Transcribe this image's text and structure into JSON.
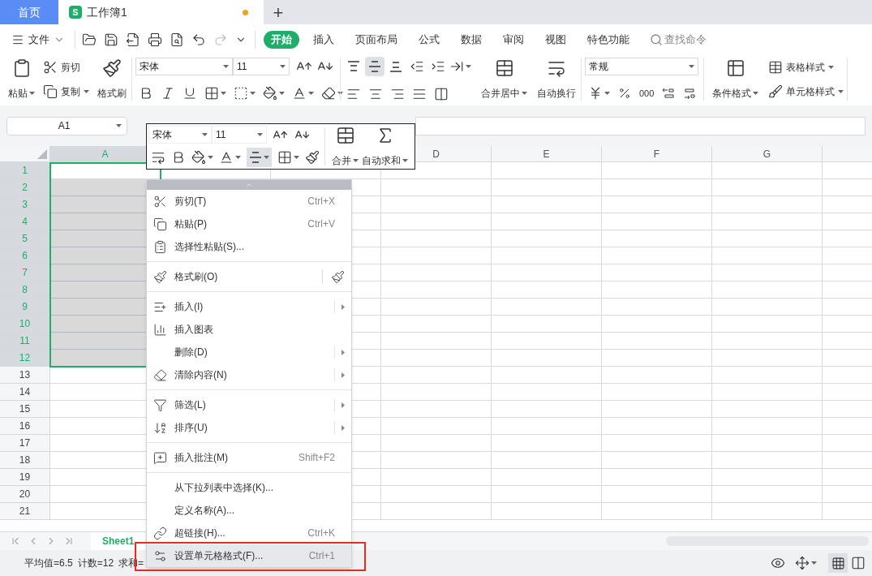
{
  "tabs": [
    {
      "label": "首页",
      "kind": "home",
      "selected": false
    },
    {
      "label": "工作簿1",
      "kind": "doc",
      "selected": true,
      "icon_letter": "S",
      "unsaved": true
    }
  ],
  "new_tab": "+",
  "menu": {
    "file": "文件",
    "tabs": [
      {
        "label": "开始",
        "selected": true
      },
      {
        "label": "插入",
        "selected": false
      },
      {
        "label": "页面布局",
        "selected": false
      },
      {
        "label": "公式",
        "selected": false
      },
      {
        "label": "数据",
        "selected": false
      },
      {
        "label": "审阅",
        "selected": false
      },
      {
        "label": "视图",
        "selected": false
      },
      {
        "label": "特色功能",
        "selected": false
      }
    ],
    "search_placeholder": "查找命令"
  },
  "ribbon": {
    "paste": "粘贴",
    "cut": "剪切",
    "copy": "复制",
    "format_painter": "格式刷",
    "font": "宋体",
    "font_size": "11",
    "vertical_align": [
      {
        "selected": false
      },
      {
        "selected": true
      },
      {
        "selected": false
      }
    ],
    "merge": "合并居中",
    "wrap": "自动换行",
    "number_format": "常规",
    "thousands": "000",
    "conditional": "条件格式",
    "table_style": "表格样式",
    "cell_style": "单元格样式"
  },
  "name_box": "A1",
  "mini_toolbar": {
    "font": "宋体",
    "font_size": "11",
    "align_selected": true,
    "merge": "合并",
    "autosum": "自动求和"
  },
  "sheet": {
    "columns": [
      {
        "label": "A",
        "selected": true
      },
      {},
      {},
      {
        "label": "D",
        "selected": false
      },
      {
        "label": "E",
        "selected": false
      },
      {
        "label": "F",
        "selected": false
      },
      {
        "label": "G",
        "selected": false
      },
      {
        "selected": false
      }
    ],
    "rows": [
      {
        "label": "1",
        "selected": true
      },
      {
        "label": "2",
        "selected": true
      },
      {
        "label": "3",
        "selected": true
      },
      {
        "label": "4",
        "selected": true
      },
      {
        "label": "5",
        "selected": true
      },
      {
        "label": "6",
        "selected": true
      },
      {
        "label": "7",
        "selected": true
      },
      {
        "label": "8",
        "selected": true
      },
      {
        "label": "9",
        "selected": true
      },
      {
        "label": "10",
        "selected": true
      },
      {
        "label": "11",
        "selected": true
      },
      {
        "label": "12",
        "selected": true
      },
      {
        "label": "13",
        "selected": false
      },
      {
        "label": "14",
        "selected": false
      },
      {
        "label": "15",
        "selected": false
      },
      {
        "label": "16",
        "selected": false
      },
      {
        "label": "17",
        "selected": false
      },
      {
        "label": "18",
        "selected": false
      },
      {
        "label": "19",
        "selected": false
      },
      {
        "label": "20",
        "selected": false
      },
      {
        "label": "21",
        "selected": false
      }
    ]
  },
  "sheet_tabs": [
    {
      "label": "Sheet1",
      "selected": true
    }
  ],
  "status": [
    "平均值=6.5",
    "计数=12",
    "求和="
  ],
  "context_menu": [
    {
      "kind": "item",
      "label": "剪切(T)",
      "shortcut": "Ctrl+X",
      "submenu": false,
      "selected": false
    },
    {
      "kind": "item",
      "label": "粘贴(P)",
      "shortcut": "Ctrl+V",
      "submenu": false,
      "selected": false
    },
    {
      "kind": "item",
      "label": "选择性粘贴(S)...",
      "submenu": false,
      "selected": false
    },
    {
      "kind": "separator"
    },
    {
      "kind": "item",
      "label": "格式刷(O)",
      "submenu": false,
      "selected": false,
      "side_button": true
    },
    {
      "kind": "separator"
    },
    {
      "kind": "item",
      "label": "插入(I)",
      "submenu": true,
      "selected": false
    },
    {
      "kind": "item",
      "label": "插入图表",
      "submenu": false,
      "selected": false
    },
    {
      "kind": "item",
      "label": "删除(D)",
      "submenu": true,
      "selected": false
    },
    {
      "kind": "item",
      "label": "清除内容(N)",
      "submenu": true,
      "selected": false
    },
    {
      "kind": "separator"
    },
    {
      "kind": "item",
      "label": "筛选(L)",
      "submenu": true,
      "selected": false
    },
    {
      "kind": "item",
      "label": "排序(U)",
      "submenu": true,
      "selected": false
    },
    {
      "kind": "separator"
    },
    {
      "kind": "item",
      "label": "插入批注(M)",
      "shortcut": "Shift+F2",
      "submenu": false,
      "selected": false
    },
    {
      "kind": "separator"
    },
    {
      "kind": "item",
      "label": "从下拉列表中选择(K)...",
      "submenu": false,
      "selected": false
    },
    {
      "kind": "item",
      "label": "定义名称(A)...",
      "submenu": false,
      "selected": false
    },
    {
      "kind": "item",
      "label": "超链接(H)...",
      "shortcut": "Ctrl+K",
      "submenu": false,
      "selected": false
    },
    {
      "kind": "item",
      "label": "设置单元格格式(F)...",
      "shortcut": "Ctrl+1",
      "submenu": false,
      "selected": true,
      "callout": true
    }
  ]
}
